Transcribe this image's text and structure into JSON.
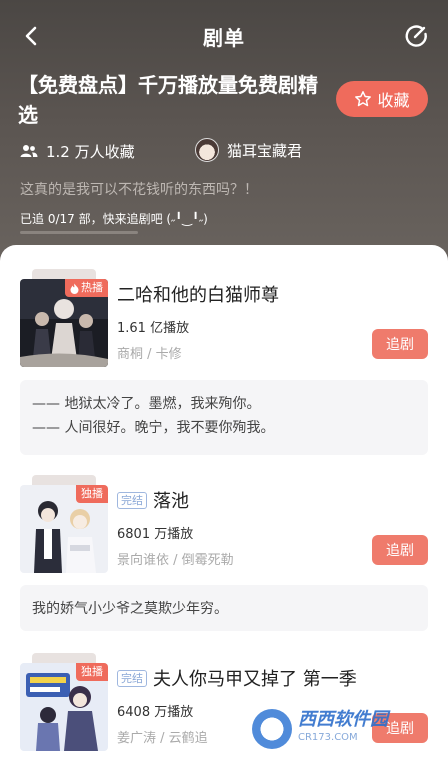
{
  "header": {
    "title": "剧单"
  },
  "playlist": {
    "title": "【免费盘点】千万播放量免费剧精选",
    "collect_label": "收藏",
    "fav_count": "1.2 万人收藏",
    "author_name": "猫耳宝藏君",
    "description": "这真的是我可以不花钱听的东西吗？！",
    "progress_text": "已追 0/17 部，快来追剧吧 (˶╹‿╹˶)",
    "progress_fraction": 0.0
  },
  "items": [
    {
      "title": "二哈和他的白猫师尊",
      "tag": "热播",
      "status": "",
      "play_count": "1.61 亿播放",
      "credits": "商桐 / 卡修",
      "follow_label": "追剧",
      "quote_lines": [
        "—— 地狱太冷了。墨燃，我来殉你。",
        "—— 人间很好。晚宁，我不要你殉我。"
      ]
    },
    {
      "title": "落池",
      "tag": "独播",
      "status": "完结",
      "play_count": "6801 万播放",
      "credits": "景向谁依 / 倒霉死勒",
      "follow_label": "追剧",
      "quote_lines": [
        "我的娇气小少爷之莫欺少年穷。"
      ]
    },
    {
      "title": "夫人你马甲又掉了 第一季",
      "tag": "独播",
      "status": "完结",
      "play_count": "6408 万播放",
      "credits": "姜广涛 / 云鹤追",
      "follow_label": "追剧",
      "quote_lines": []
    }
  ],
  "watermark": {
    "brand": "西西软件园",
    "url": "CR173.COM"
  },
  "colors": {
    "accent": "#ef6b5c",
    "hero_bg": "#524c48"
  }
}
